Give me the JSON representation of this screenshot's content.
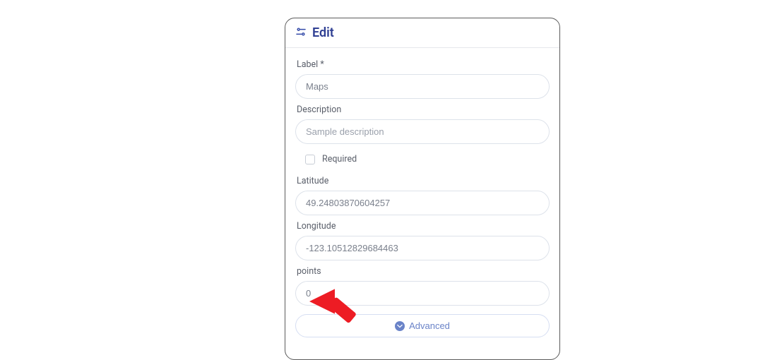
{
  "panel": {
    "title": "Edit",
    "fields": {
      "label": {
        "label": "Label *",
        "value": "Maps"
      },
      "description": {
        "label": "Description",
        "placeholder": "Sample description",
        "value": ""
      },
      "required": {
        "label": "Required",
        "checked": false
      },
      "latitude": {
        "label": "Latitude",
        "value": "49.24803870604257"
      },
      "longitude": {
        "label": "Longitude",
        "value": "-123.10512829684463"
      },
      "points": {
        "label": "points",
        "value": "0"
      }
    },
    "advanced_label": "Advanced"
  },
  "annotation": {
    "arrow_color": "#ed1c24",
    "target": "points-input"
  }
}
